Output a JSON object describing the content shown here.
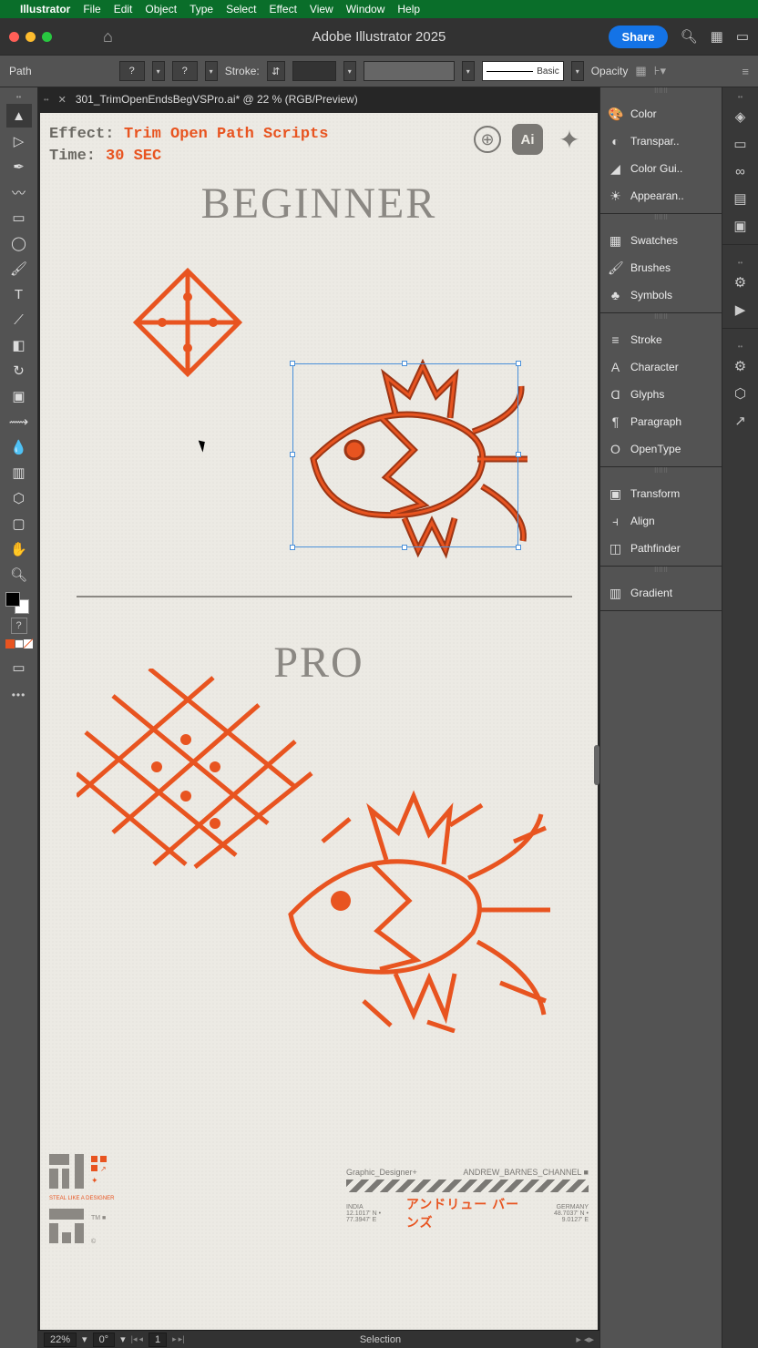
{
  "menubar": {
    "app": "Illustrator",
    "items": [
      "File",
      "Edit",
      "Object",
      "Type",
      "Select",
      "Effect",
      "View",
      "Window",
      "Help"
    ]
  },
  "titlebar": {
    "title": "Adobe Illustrator 2025",
    "share": "Share"
  },
  "controlbar": {
    "path_label": "Path",
    "stroke_label": "Stroke:",
    "basic_label": "Basic",
    "opacity_label": "Opacity"
  },
  "doc_tab": {
    "name": "301_TrimOpenEndsBegVSPro.ai* @ 22 % (RGB/Preview)"
  },
  "canvas": {
    "effect_label": "Effect:",
    "effect_value": "Trim Open Path Scripts",
    "time_label": "Time:",
    "time_value": "30 SEC",
    "heading_top": "BEGINNER",
    "heading_bottom": "PRO",
    "corner_ai": "Ai",
    "footer_left_tag": "STEAL LIKE A DESIGNER",
    "footer_left_tm": "TM",
    "footer_right_gd_l": "Graphic_Designer+",
    "footer_right_gd_r": "ANDREW_BARNES_CHANNEL ■",
    "footer_right_loc1": "INDIA",
    "footer_right_coord1": "12.1017' N • 77.3947' E",
    "footer_right_jp": "アンドリュー バーンズ",
    "footer_right_loc2": "GERMANY",
    "footer_right_coord2": "48.7037' N • 9.0127' E"
  },
  "statusbar": {
    "zoom": "22%",
    "rotate": "0°",
    "artboard": "1",
    "mode": "Selection"
  },
  "panels": {
    "g1": [
      "Color",
      "Transpar..",
      "Color Gui..",
      "Appearan.."
    ],
    "g2": [
      "Swatches",
      "Brushes",
      "Symbols"
    ],
    "g3": [
      "Stroke",
      "Character",
      "Glyphs",
      "Paragraph",
      "OpenType"
    ],
    "g4": [
      "Transform",
      "Align",
      "Pathfinder"
    ],
    "g5": [
      "Gradient"
    ]
  }
}
